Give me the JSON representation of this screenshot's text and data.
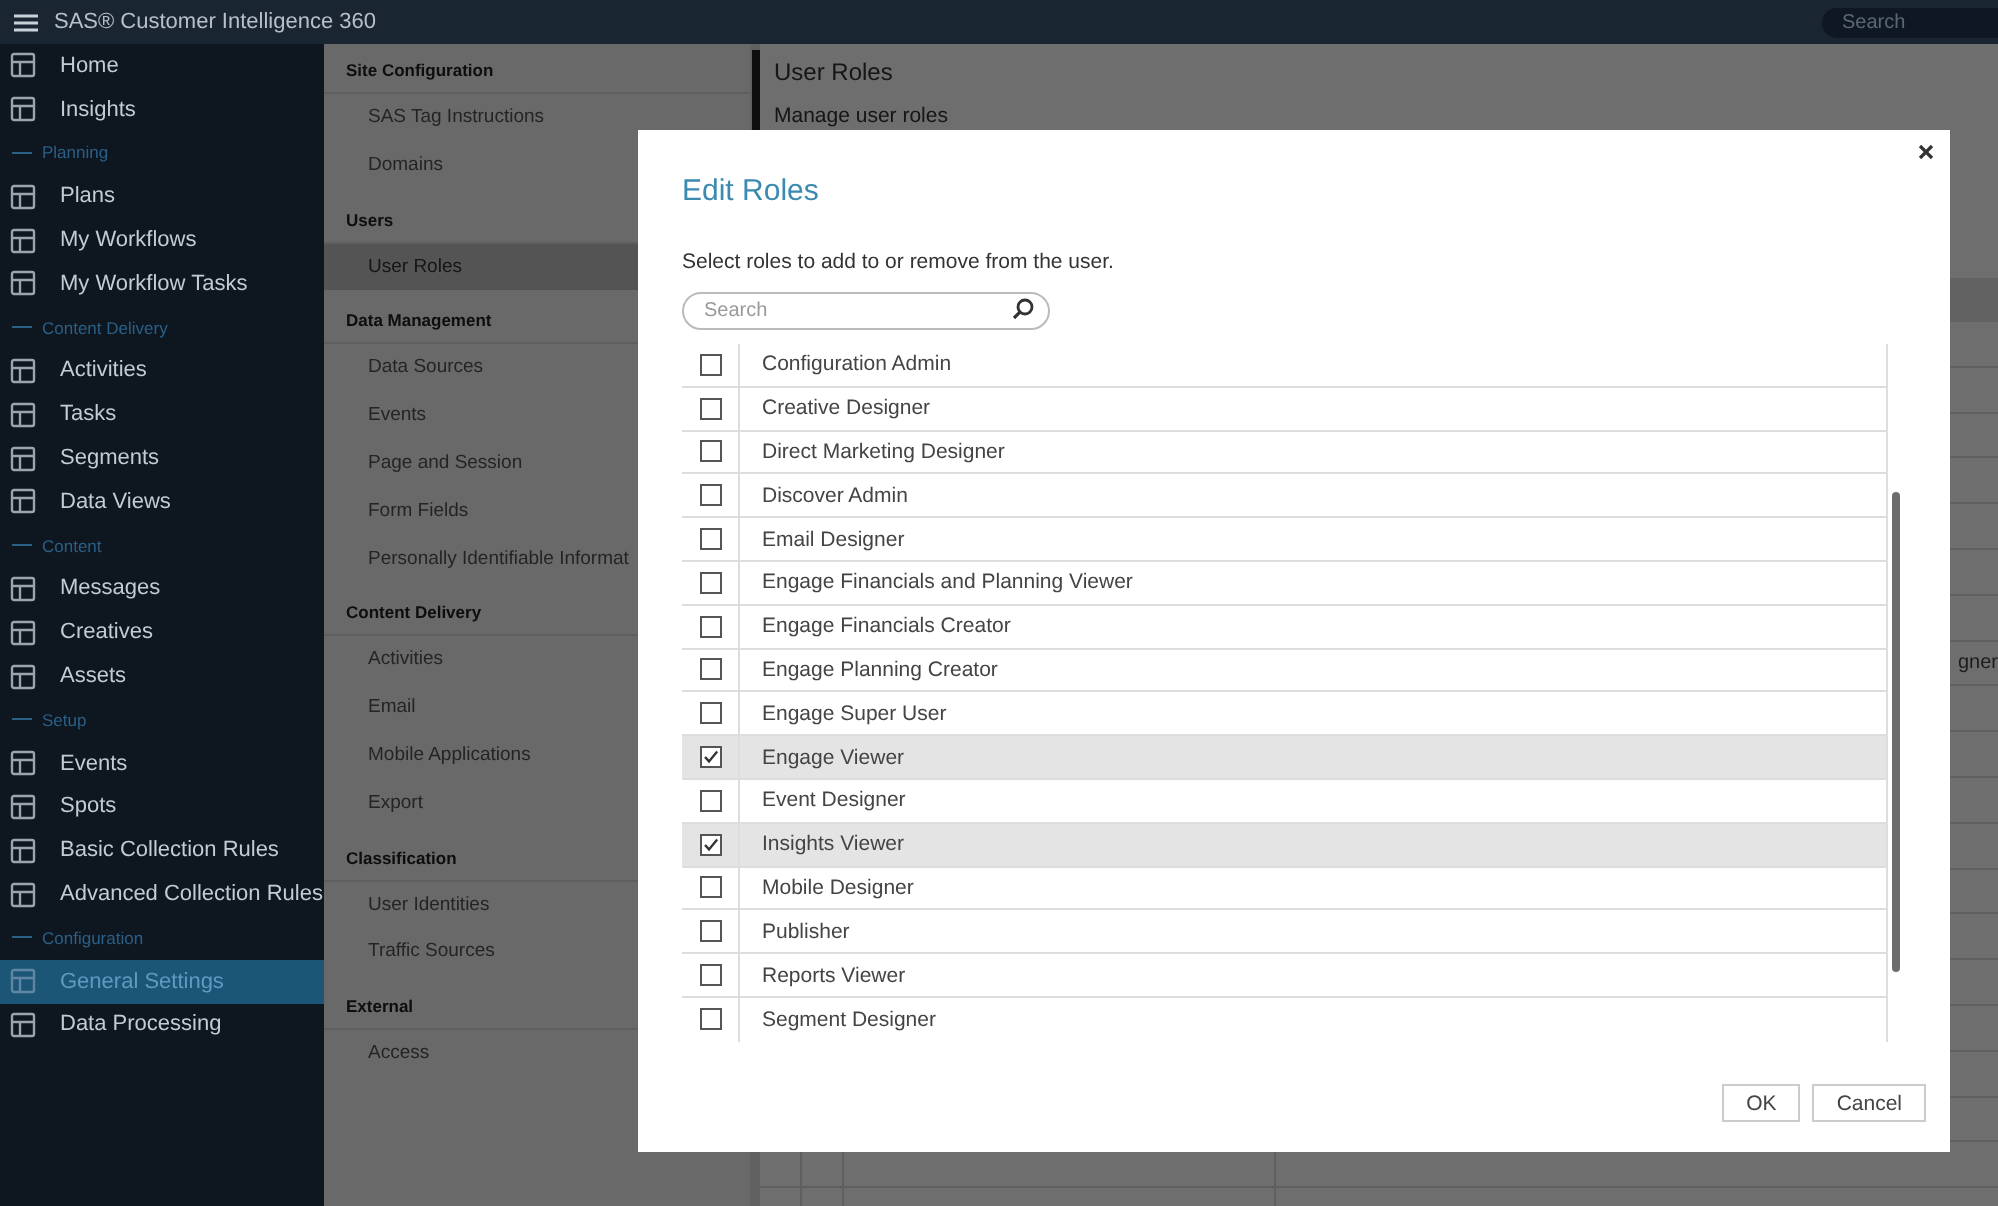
{
  "app": {
    "title": "SAS® Customer Intelligence 360",
    "search": {
      "placeholder": "Search"
    }
  },
  "sidebar": [
    {
      "kind": "item",
      "label": "Home",
      "selected": false
    },
    {
      "kind": "item",
      "label": "Insights",
      "selected": false
    },
    {
      "kind": "section",
      "label": "Planning"
    },
    {
      "kind": "item",
      "label": "Plans",
      "selected": false
    },
    {
      "kind": "item",
      "label": "My Workflows",
      "selected": false
    },
    {
      "kind": "item",
      "label": "My Workflow Tasks",
      "selected": false
    },
    {
      "kind": "section",
      "label": "Content Delivery"
    },
    {
      "kind": "item",
      "label": "Activities",
      "selected": false
    },
    {
      "kind": "item",
      "label": "Tasks",
      "selected": false
    },
    {
      "kind": "item",
      "label": "Segments",
      "selected": false
    },
    {
      "kind": "item",
      "label": "Data Views",
      "selected": false
    },
    {
      "kind": "section",
      "label": "Content"
    },
    {
      "kind": "item",
      "label": "Messages",
      "selected": false
    },
    {
      "kind": "item",
      "label": "Creatives",
      "selected": false
    },
    {
      "kind": "item",
      "label": "Assets",
      "selected": false
    },
    {
      "kind": "section",
      "label": "Setup"
    },
    {
      "kind": "item",
      "label": "Events",
      "selected": false
    },
    {
      "kind": "item",
      "label": "Spots",
      "selected": false
    },
    {
      "kind": "item",
      "label": "Basic Collection Rules",
      "selected": false
    },
    {
      "kind": "item",
      "label": "Advanced Collection Rules",
      "selected": false
    },
    {
      "kind": "section",
      "label": "Configuration"
    },
    {
      "kind": "item",
      "label": "General Settings",
      "selected": true
    },
    {
      "kind": "item",
      "label": "Data Processing",
      "selected": false
    }
  ],
  "settings_nav": [
    {
      "heading": "Site Configuration",
      "items": [
        {
          "label": "SAS Tag Instructions",
          "selected": false
        },
        {
          "label": "Domains",
          "selected": false
        }
      ]
    },
    {
      "heading": "Users",
      "items": [
        {
          "label": "User Roles",
          "selected": true
        }
      ]
    },
    {
      "heading": "Data Management",
      "items": [
        {
          "label": "Data Sources",
          "selected": false
        },
        {
          "label": "Events",
          "selected": false
        },
        {
          "label": "Page and Session",
          "selected": false
        },
        {
          "label": "Form Fields",
          "selected": false
        },
        {
          "label": "Personally Identifiable Informat",
          "selected": false
        }
      ]
    },
    {
      "heading": "Content Delivery",
      "items": [
        {
          "label": "Activities",
          "selected": false
        },
        {
          "label": "Email",
          "selected": false
        },
        {
          "label": "Mobile Applications",
          "selected": false
        },
        {
          "label": "Export",
          "selected": false
        }
      ]
    },
    {
      "heading": "Classification",
      "items": [
        {
          "label": "User Identities",
          "selected": false
        },
        {
          "label": "Traffic Sources",
          "selected": false
        }
      ]
    },
    {
      "heading": "External",
      "items": [
        {
          "label": "Access",
          "selected": false
        }
      ]
    }
  ],
  "page": {
    "title": "User Roles",
    "subtitle": "Manage user roles",
    "table_cell": "gner"
  },
  "dialog": {
    "title": "Edit Roles",
    "instruction": "Select roles to add to or remove from the user.",
    "search": {
      "placeholder": "Search"
    },
    "roles": [
      {
        "name": "Configuration Admin",
        "checked": false
      },
      {
        "name": "Creative Designer",
        "checked": false
      },
      {
        "name": "Direct Marketing Designer",
        "checked": false
      },
      {
        "name": "Discover Admin",
        "checked": false
      },
      {
        "name": "Email Designer",
        "checked": false
      },
      {
        "name": "Engage Financials and Planning Viewer",
        "checked": false
      },
      {
        "name": "Engage Financials Creator",
        "checked": false
      },
      {
        "name": "Engage Planning Creator",
        "checked": false
      },
      {
        "name": "Engage Super User",
        "checked": false
      },
      {
        "name": "Engage Viewer",
        "checked": true
      },
      {
        "name": "Event Designer",
        "checked": false
      },
      {
        "name": "Insights Viewer",
        "checked": true
      },
      {
        "name": "Mobile Designer",
        "checked": false
      },
      {
        "name": "Publisher",
        "checked": false
      },
      {
        "name": "Reports Viewer",
        "checked": false
      },
      {
        "name": "Segment Designer",
        "checked": false
      }
    ],
    "buttons": [
      "OK",
      "Cancel"
    ]
  }
}
